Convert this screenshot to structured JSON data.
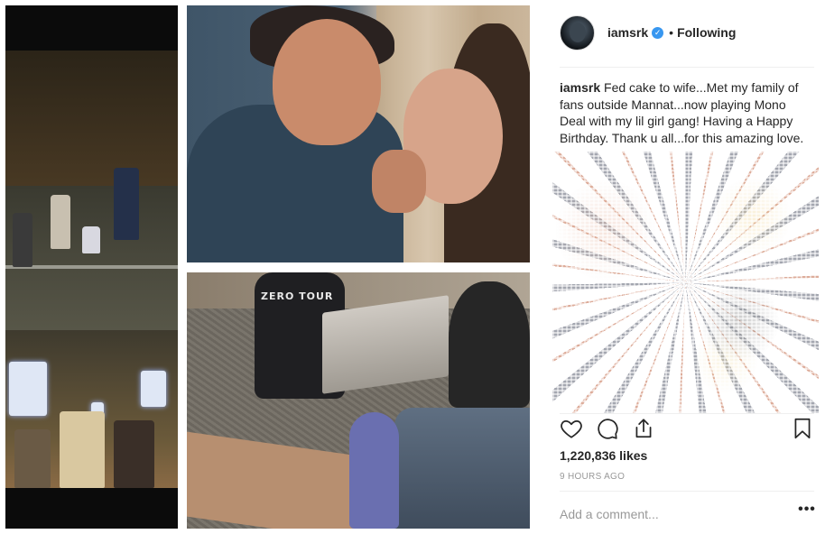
{
  "post": {
    "username": "iamsrk",
    "verified": true,
    "follow_separator": "•",
    "follow_state": "Following",
    "caption_text": "Fed cake to wife...Met my family of fans outside Mannat...now playing Mono Deal with my lil girl gang! Having a Happy Birthday. Thank u all...for this amazing love.",
    "likes": "1,220,836 likes",
    "time_ago": "9 HOURS AGO",
    "comment_placeholder": "Add a comment...",
    "more_label": "•••"
  },
  "photos": {
    "cards_shirt_text": "ZERO TOUR"
  },
  "icons": {
    "like": "heart-icon",
    "comment": "comment-icon",
    "share": "share-icon",
    "save": "bookmark-icon",
    "verified": "verified-badge-icon"
  },
  "colors": {
    "verified": "#3897f0",
    "text": "#262626",
    "muted": "#999999",
    "divider": "#efefef"
  }
}
